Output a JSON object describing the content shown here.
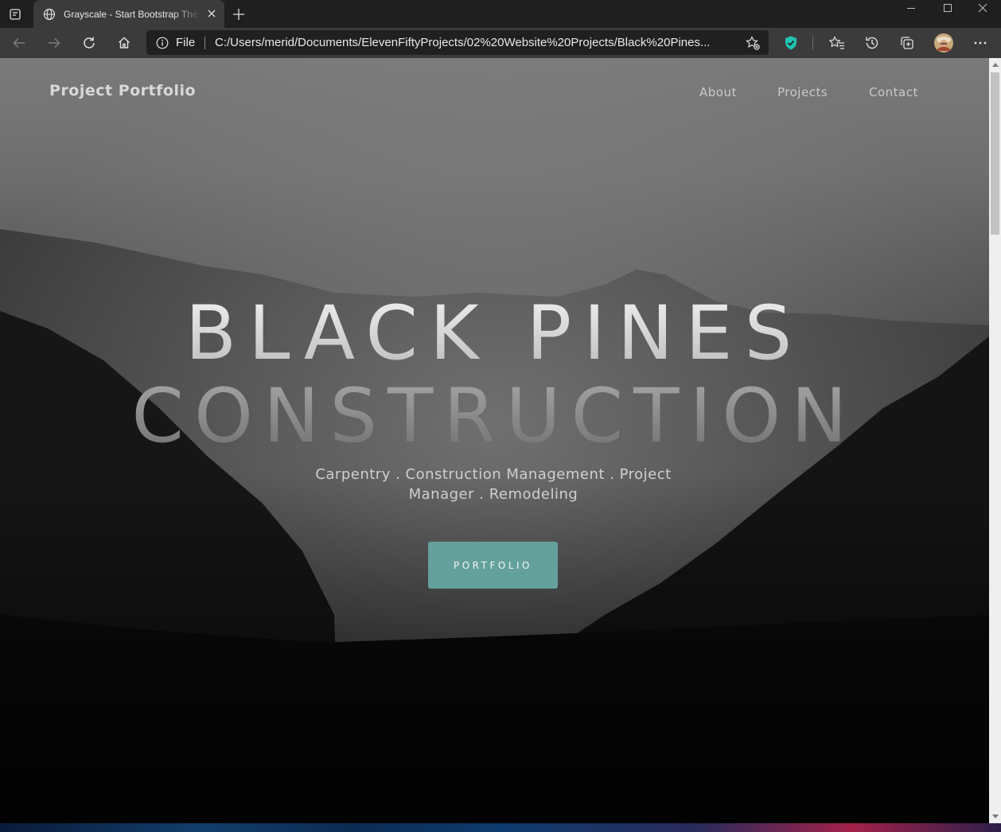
{
  "browser": {
    "tab": {
      "title": "Grayscale - Start Bootstrap Theme",
      "favicon": "globe-icon"
    },
    "address": {
      "scheme_label": "File",
      "url": "C:/Users/merid/Documents/ElevenFiftyProjects/02%20Website%20Projects/Black%20Pines..."
    },
    "icons": [
      "tab-actions-icon",
      "globe-icon",
      "close-icon",
      "plus-icon",
      "minimize-icon",
      "maximize-icon",
      "window-close-icon",
      "back-arrow-icon",
      "forward-arrow-icon",
      "refresh-icon",
      "home-icon",
      "info-icon",
      "add-favorite-icon",
      "shield-extension-icon",
      "favorites-icon",
      "history-icon",
      "collections-icon",
      "profile-avatar-icon",
      "more-icon"
    ],
    "colors": {
      "tab_bar": "#1f1f1f",
      "toolbar": "#3b3b3b",
      "address_bg": "#202020",
      "shield": "#22c2b0"
    }
  },
  "page": {
    "nav": {
      "brand": "Project Portfolio",
      "links": [
        "About",
        "Projects",
        "Contact"
      ]
    },
    "hero": {
      "title_line1": "BLACK PINES",
      "title_line2": "CONSTRUCTION",
      "subtitle": "Carpentry . Construction Management . Project Manager . Remodeling",
      "button": "PORTFOLIO"
    },
    "colors": {
      "button": "#64a19d"
    }
  }
}
